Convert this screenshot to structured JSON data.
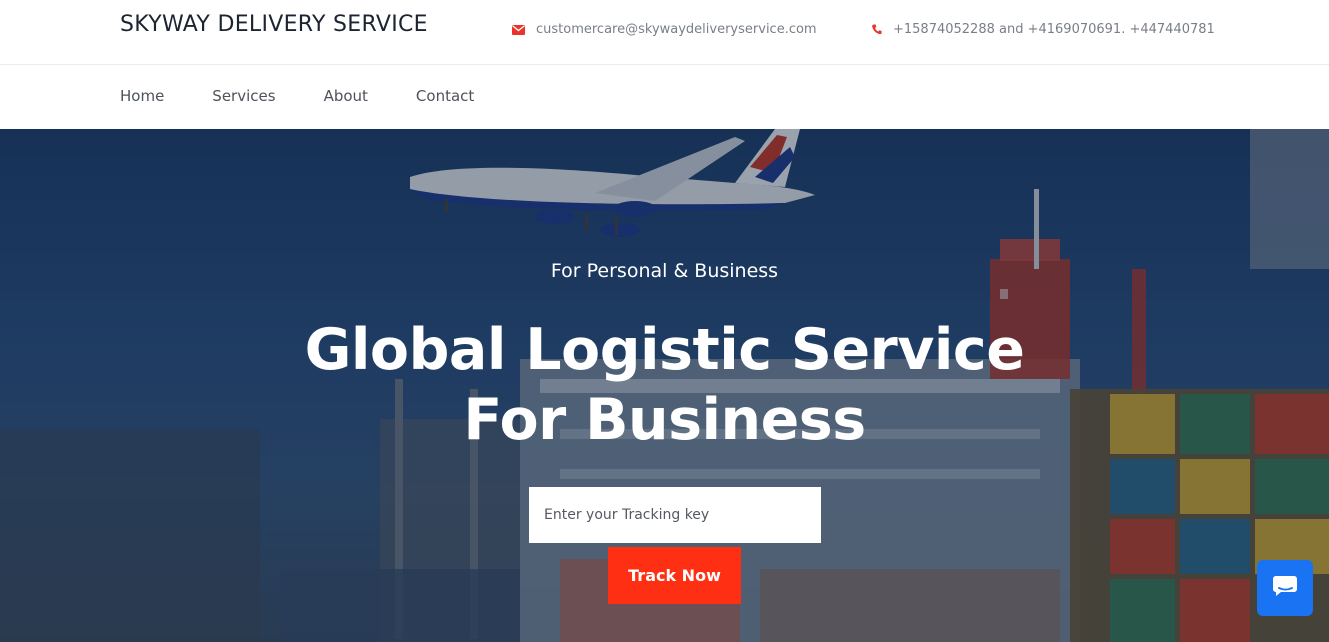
{
  "header": {
    "brand": "SKYWAY DELIVERY SERVICE",
    "email": {
      "icon": "envelope-icon",
      "text": "customercare@skywaydeliveryservice.com"
    },
    "phone": {
      "icon": "phone-icon",
      "text": "+15874052288 and +4169070691. +447440781"
    }
  },
  "nav": {
    "items": [
      {
        "label": "Home"
      },
      {
        "label": "Services"
      },
      {
        "label": "About"
      },
      {
        "label": "Contact"
      }
    ]
  },
  "hero": {
    "eyebrow": "For Personal & Business",
    "headline_line1": "Global Logistic Service",
    "headline_line2": "For Business",
    "tracking_placeholder": "Enter your Tracking key",
    "track_button": "Track Now"
  },
  "chat": {
    "icon": "chat-bubble-icon"
  },
  "colors": {
    "accent": "#ff2f14",
    "chat": "#1a73f3",
    "brand_text": "#1b2430",
    "contact_icon": "#e8342a"
  }
}
